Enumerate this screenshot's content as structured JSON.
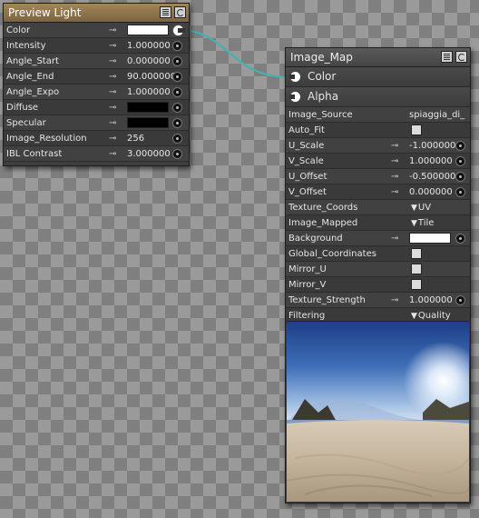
{
  "preview_node": {
    "title": "Preview Light",
    "rows": [
      {
        "label": "Color",
        "kind": "color",
        "color": "#ffffff",
        "connected": true
      },
      {
        "label": "Intensity",
        "kind": "number",
        "value": "1.000000"
      },
      {
        "label": "Angle_Start",
        "kind": "number",
        "value": "0.000000"
      },
      {
        "label": "Angle_End",
        "kind": "number",
        "value": "90.000000"
      },
      {
        "label": "Angle_Expo",
        "kind": "number",
        "value": "1.000000"
      },
      {
        "label": "Diffuse",
        "kind": "color",
        "color": "#000000"
      },
      {
        "label": "Specular",
        "kind": "color",
        "color": "#000000"
      },
      {
        "label": "Image_Resolution",
        "kind": "number",
        "value": "256"
      },
      {
        "label": "IBL Contrast",
        "kind": "number",
        "value": "3.000000"
      }
    ]
  },
  "image_map_node": {
    "title": "Image_Map",
    "outputs": [
      {
        "label": "Color"
      },
      {
        "label": "Alpha"
      }
    ],
    "rows": [
      {
        "label": "Image_Source",
        "kind": "text",
        "value": "spiaggia_di_"
      },
      {
        "label": "Auto_Fit",
        "kind": "check"
      },
      {
        "label": "U_Scale",
        "kind": "number",
        "value": "-1.000000"
      },
      {
        "label": "V_Scale",
        "kind": "number",
        "value": "1.000000"
      },
      {
        "label": "U_Offset",
        "kind": "number",
        "value": "-0.500000"
      },
      {
        "label": "V_Offset",
        "kind": "number",
        "value": "0.000000"
      },
      {
        "label": "Texture_Coords",
        "kind": "dropdown",
        "value": "UV"
      },
      {
        "label": "Image_Mapped",
        "kind": "dropdown",
        "value": "Tile"
      },
      {
        "label": "Background",
        "kind": "color",
        "color": "#ffffff"
      },
      {
        "label": "Global_Coordinates",
        "kind": "check"
      },
      {
        "label": "Mirror_U",
        "kind": "check"
      },
      {
        "label": "Mirror_V",
        "kind": "check"
      },
      {
        "label": "Texture_Strength",
        "kind": "number",
        "value": "1.000000"
      },
      {
        "label": "Filtering",
        "kind": "dropdown",
        "value": "Quality"
      }
    ]
  },
  "colors": {
    "wire": "#3fb3b3",
    "preview_title": "#8f7550",
    "node_body": "#3e3e3e"
  },
  "icons": {
    "key": "key-icon",
    "port": "input-port-icon",
    "dropdown": "dropdown-arrow-icon"
  },
  "glyphs": {
    "key": "⊸",
    "arrow": "▼"
  }
}
